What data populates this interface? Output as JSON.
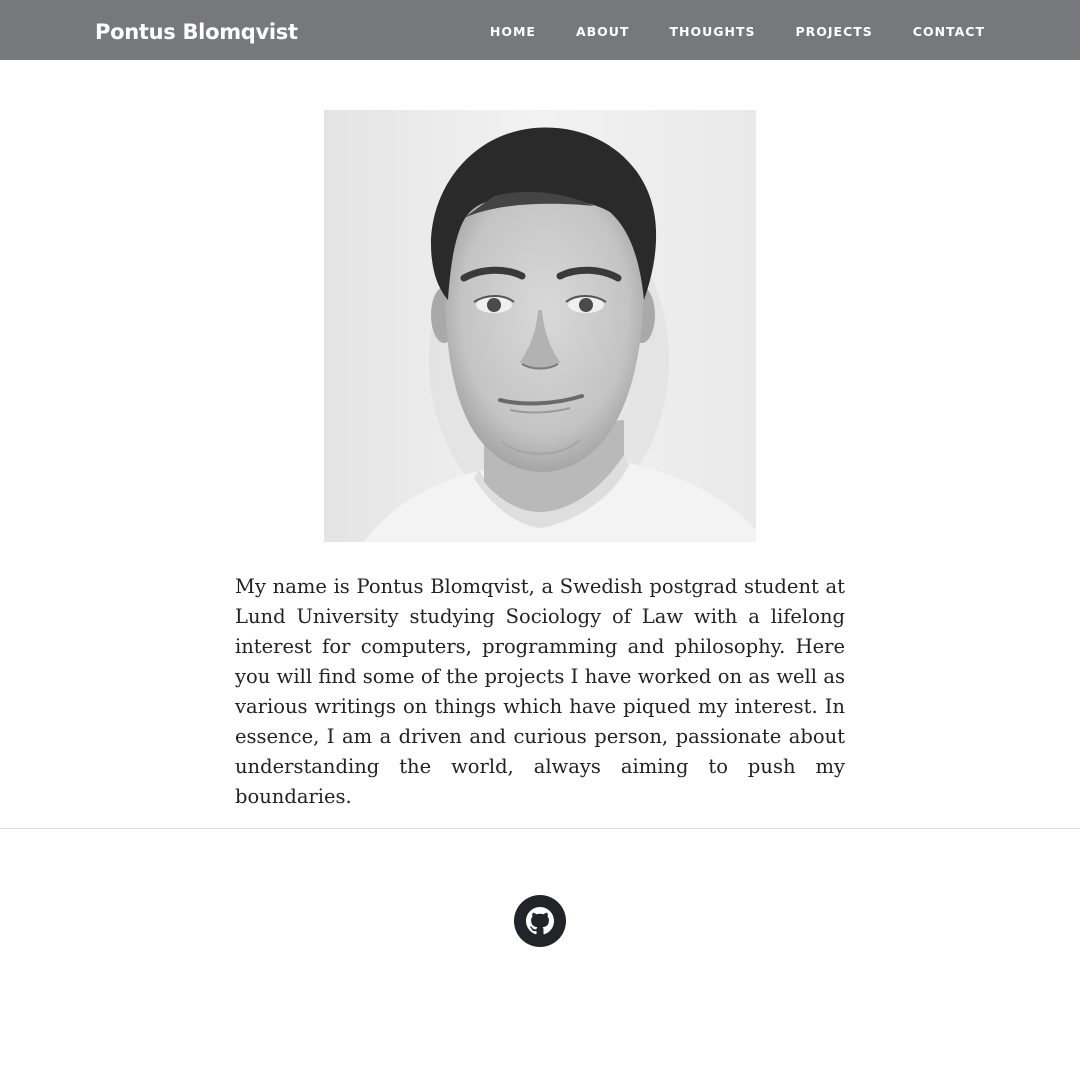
{
  "header": {
    "brand": "Pontus Blomqvist",
    "nav": [
      {
        "label": "HOME"
      },
      {
        "label": "ABOUT"
      },
      {
        "label": "THOUGHTS"
      },
      {
        "label": "PROJECTS"
      },
      {
        "label": "CONTACT"
      }
    ],
    "background_color": "#77787b"
  },
  "main": {
    "portrait_icon": "profile-photo",
    "intro": "My name is Pontus Blomqvist, a Swedish postgrad student at Lund University studying Sociology of Law with a lifelong interest for computers, programming and philosophy. Here you will find some of the projects I have worked on as well as various writings on things which have piqued my interest. In essence, I am a driven and curious person, passionate about understanding the world, always aiming to push my boundaries."
  },
  "footer": {
    "social": [
      {
        "icon": "github-icon"
      }
    ],
    "icon_color": "#222429"
  }
}
